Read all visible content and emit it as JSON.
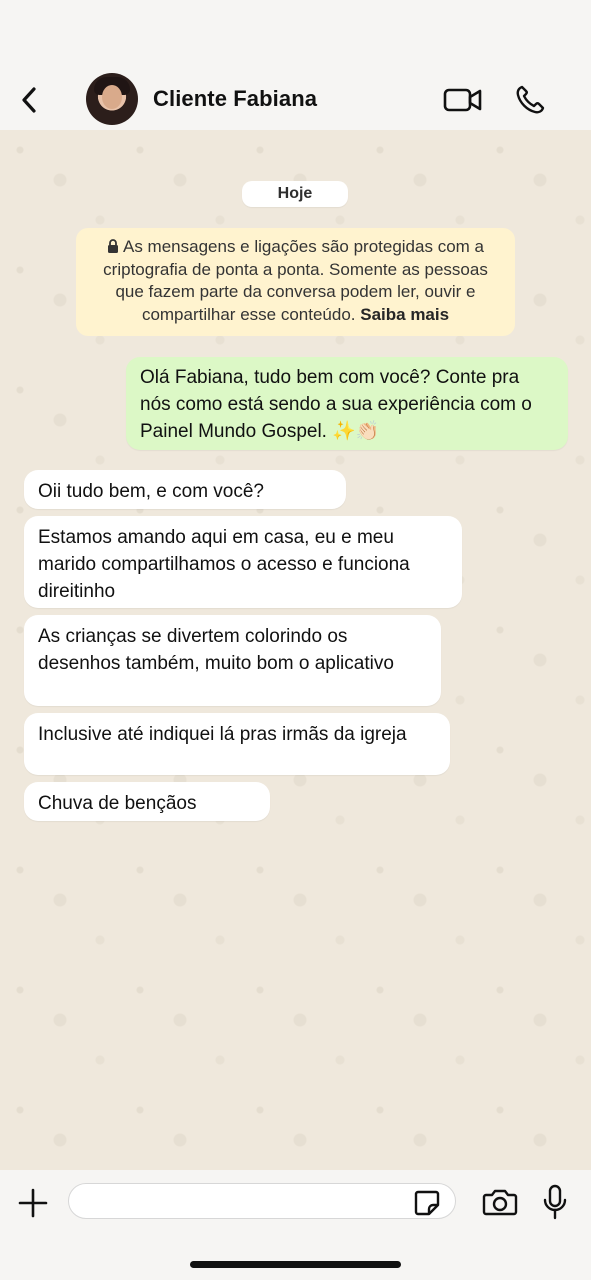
{
  "header": {
    "contact_name": "Cliente Fabiana"
  },
  "chat": {
    "date_label": "Hoje",
    "encryption_notice": {
      "text": "As mensagens e ligações são protegidas com a criptografia de ponta a ponta. Somente as pessoas que fazem parte da conversa podem ler, ouvir e compartilhar esse conteúdo.",
      "link": "Saiba mais"
    },
    "messages": [
      {
        "direction": "outgoing",
        "text": "Olá Fabiana, tudo bem com você? Conte pra nós como está sendo a sua experiência com o Painel Mundo Gospel. ✨👏🏻"
      },
      {
        "direction": "incoming",
        "text": "Oii tudo bem, e com você?"
      },
      {
        "direction": "incoming",
        "text": "Estamos amando aqui em casa, eu e meu marido compartilhamos o acesso e funciona direitinho"
      },
      {
        "direction": "incoming",
        "text": "As crianças se divertem colorindo os desenhos também, muito bom o aplicativo"
      },
      {
        "direction": "incoming",
        "text": "Inclusive até indiquei lá pras irmãs da igreja"
      },
      {
        "direction": "incoming",
        "text": "Chuva de bençãos"
      }
    ]
  },
  "composer": {
    "value": "",
    "placeholder": ""
  },
  "icons": {
    "back": "chevron-left-icon",
    "video": "video-camera-icon",
    "call": "phone-icon",
    "plus": "plus-icon",
    "sticker": "sticker-icon",
    "camera": "camera-icon",
    "mic": "microphone-icon",
    "lock": "lock-icon"
  },
  "colors": {
    "outgoing_bubble": "#dcf8c6",
    "incoming_bubble": "#ffffff",
    "encryption_notice_bg": "#fff3cf",
    "chat_background": "#efe8dc"
  }
}
